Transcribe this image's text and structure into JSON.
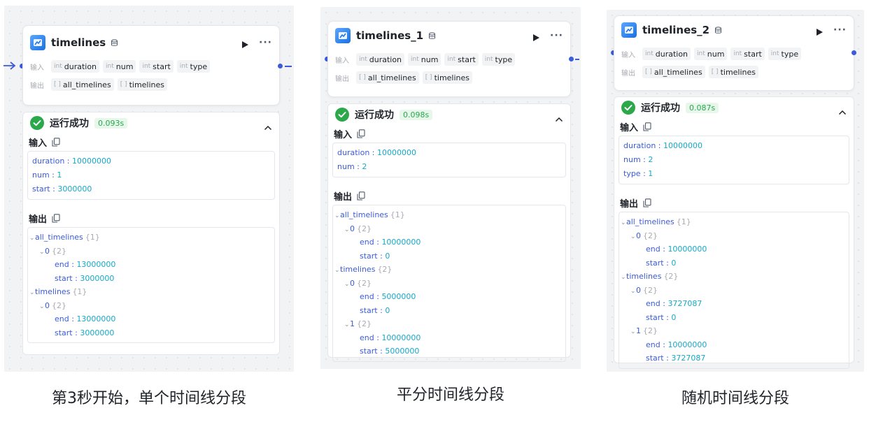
{
  "panels": [
    {
      "node": {
        "title": "timelines",
        "input_label": "输入",
        "output_label": "输出",
        "inputs": [
          {
            "type": "int",
            "name": "duration"
          },
          {
            "type": "int",
            "name": "num"
          },
          {
            "type": "int",
            "name": "start"
          },
          {
            "type": "int",
            "name": "type"
          }
        ],
        "outputs": [
          {
            "type": "[ ]",
            "name": "all_timelines"
          },
          {
            "type": "[ ]",
            "name": "timelines"
          }
        ]
      },
      "result": {
        "status": "运行成功",
        "time": "0.093s",
        "input_title": "输入",
        "output_title": "输出",
        "input_values": [
          {
            "key": "duration",
            "value": "10000000"
          },
          {
            "key": "num",
            "value": "1"
          },
          {
            "key": "start",
            "value": "3000000"
          }
        ],
        "output_tree": [
          {
            "key": "all_timelines",
            "count": "{1}",
            "children": [
              {
                "key": "0",
                "count": "{2}",
                "children": [
                  {
                    "key": "end",
                    "value": "13000000"
                  },
                  {
                    "key": "start",
                    "value": "3000000"
                  }
                ]
              }
            ]
          },
          {
            "key": "timelines",
            "count": "{1}",
            "children": [
              {
                "key": "0",
                "count": "{2}",
                "children": [
                  {
                    "key": "end",
                    "value": "13000000"
                  },
                  {
                    "key": "start",
                    "value": "3000000"
                  }
                ]
              }
            ]
          }
        ]
      },
      "caption": "第3秒开始，单个时间线分段"
    },
    {
      "node": {
        "title": "timelines_1",
        "input_label": "输入",
        "output_label": "输出",
        "inputs": [
          {
            "type": "int",
            "name": "duration"
          },
          {
            "type": "int",
            "name": "num"
          },
          {
            "type": "int",
            "name": "start"
          },
          {
            "type": "int",
            "name": "type"
          }
        ],
        "outputs": [
          {
            "type": "[ ]",
            "name": "all_timelines"
          },
          {
            "type": "[ ]",
            "name": "timelines"
          }
        ]
      },
      "result": {
        "status": "运行成功",
        "time": "0.098s",
        "input_title": "输入",
        "output_title": "输出",
        "input_values": [
          {
            "key": "duration",
            "value": "10000000"
          },
          {
            "key": "num",
            "value": "2"
          }
        ],
        "output_tree": [
          {
            "key": "all_timelines",
            "count": "{1}",
            "children": [
              {
                "key": "0",
                "count": "{2}",
                "children": [
                  {
                    "key": "end",
                    "value": "10000000"
                  },
                  {
                    "key": "start",
                    "value": "0"
                  }
                ]
              }
            ]
          },
          {
            "key": "timelines",
            "count": "{2}",
            "children": [
              {
                "key": "0",
                "count": "{2}",
                "children": [
                  {
                    "key": "end",
                    "value": "5000000"
                  },
                  {
                    "key": "start",
                    "value": "0"
                  }
                ]
              },
              {
                "key": "1",
                "count": "{2}",
                "children": [
                  {
                    "key": "end",
                    "value": "10000000"
                  },
                  {
                    "key": "start",
                    "value": "5000000"
                  }
                ]
              }
            ]
          }
        ]
      },
      "caption": "平分时间线分段"
    },
    {
      "node": {
        "title": "timelines_2",
        "input_label": "输入",
        "output_label": "输出",
        "inputs": [
          {
            "type": "int",
            "name": "duration"
          },
          {
            "type": "int",
            "name": "num"
          },
          {
            "type": "int",
            "name": "start"
          },
          {
            "type": "int",
            "name": "type"
          }
        ],
        "outputs": [
          {
            "type": "[ ]",
            "name": "all_timelines"
          },
          {
            "type": "[ ]",
            "name": "timelines"
          }
        ]
      },
      "result": {
        "status": "运行成功",
        "time": "0.087s",
        "input_title": "输入",
        "output_title": "输出",
        "input_values": [
          {
            "key": "duration",
            "value": "10000000"
          },
          {
            "key": "num",
            "value": "2"
          },
          {
            "key": "type",
            "value": "1"
          }
        ],
        "output_tree": [
          {
            "key": "all_timelines",
            "count": "{1}",
            "children": [
              {
                "key": "0",
                "count": "{2}",
                "children": [
                  {
                    "key": "end",
                    "value": "10000000"
                  },
                  {
                    "key": "start",
                    "value": "0"
                  }
                ]
              }
            ]
          },
          {
            "key": "timelines",
            "count": "{2}",
            "children": [
              {
                "key": "0",
                "count": "{2}",
                "children": [
                  {
                    "key": "end",
                    "value": "3727087"
                  },
                  {
                    "key": "start",
                    "value": "0"
                  }
                ]
              },
              {
                "key": "1",
                "count": "{2}",
                "children": [
                  {
                    "key": "end",
                    "value": "10000000"
                  },
                  {
                    "key": "start",
                    "value": "3727087"
                  }
                ]
              }
            ]
          }
        ]
      },
      "caption": "随机时间线分段"
    }
  ],
  "colors": {
    "accent": "#3b5bdb",
    "success": "#2ba84a",
    "value": "#16a8c6",
    "muted": "#a8abb2"
  },
  "icons": [
    "node-logo-icon",
    "database-icon",
    "run-icon",
    "more-icon",
    "success-icon",
    "chevron-up-icon",
    "copy-icon",
    "tree-toggle-icon",
    "arrow-right-icon"
  ]
}
